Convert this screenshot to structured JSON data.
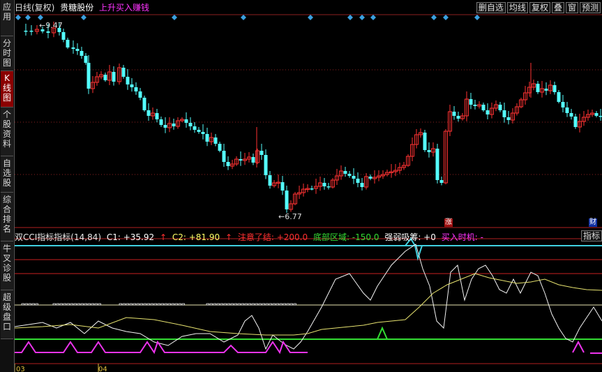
{
  "sidebar": {
    "tabs": [
      {
        "label": "应用",
        "active": false
      },
      {
        "label": "分时图",
        "active": false
      },
      {
        "label": "K线图",
        "active": true
      },
      {
        "label": "个股资料",
        "active": false
      },
      {
        "label": "自选股",
        "active": false
      },
      {
        "label": "综合排名",
        "active": false
      },
      {
        "label": "牛叉诊股",
        "active": false
      },
      {
        "label": "超级盘口",
        "active": false
      }
    ]
  },
  "header": {
    "period": "日线(复权)",
    "stock": "贵糖股份",
    "strategy": "上升买入赚钱",
    "buttons": [
      "删自选",
      "均线",
      "复权",
      "叠",
      "窗",
      "预测"
    ]
  },
  "price_panel": {
    "high_label": "9.47",
    "low_label": "6.77",
    "badge_up": "涨",
    "badge_fin": "财"
  },
  "indicator": {
    "name": "双CCI指标指标(14,84)",
    "c1": "C1: +35.92",
    "c2": "C2: +81.90",
    "attention": "注意了结: +200.0",
    "bottom": "底部区域: -150.0",
    "strength": "强弱吸筹: +0",
    "buy": "买入时机: -",
    "button": "指标"
  },
  "dates": {
    "left": "03",
    "mid": "04"
  },
  "colors": {
    "up": "#ff3232",
    "down": "#54fcfc",
    "bg": "#000000"
  }
}
